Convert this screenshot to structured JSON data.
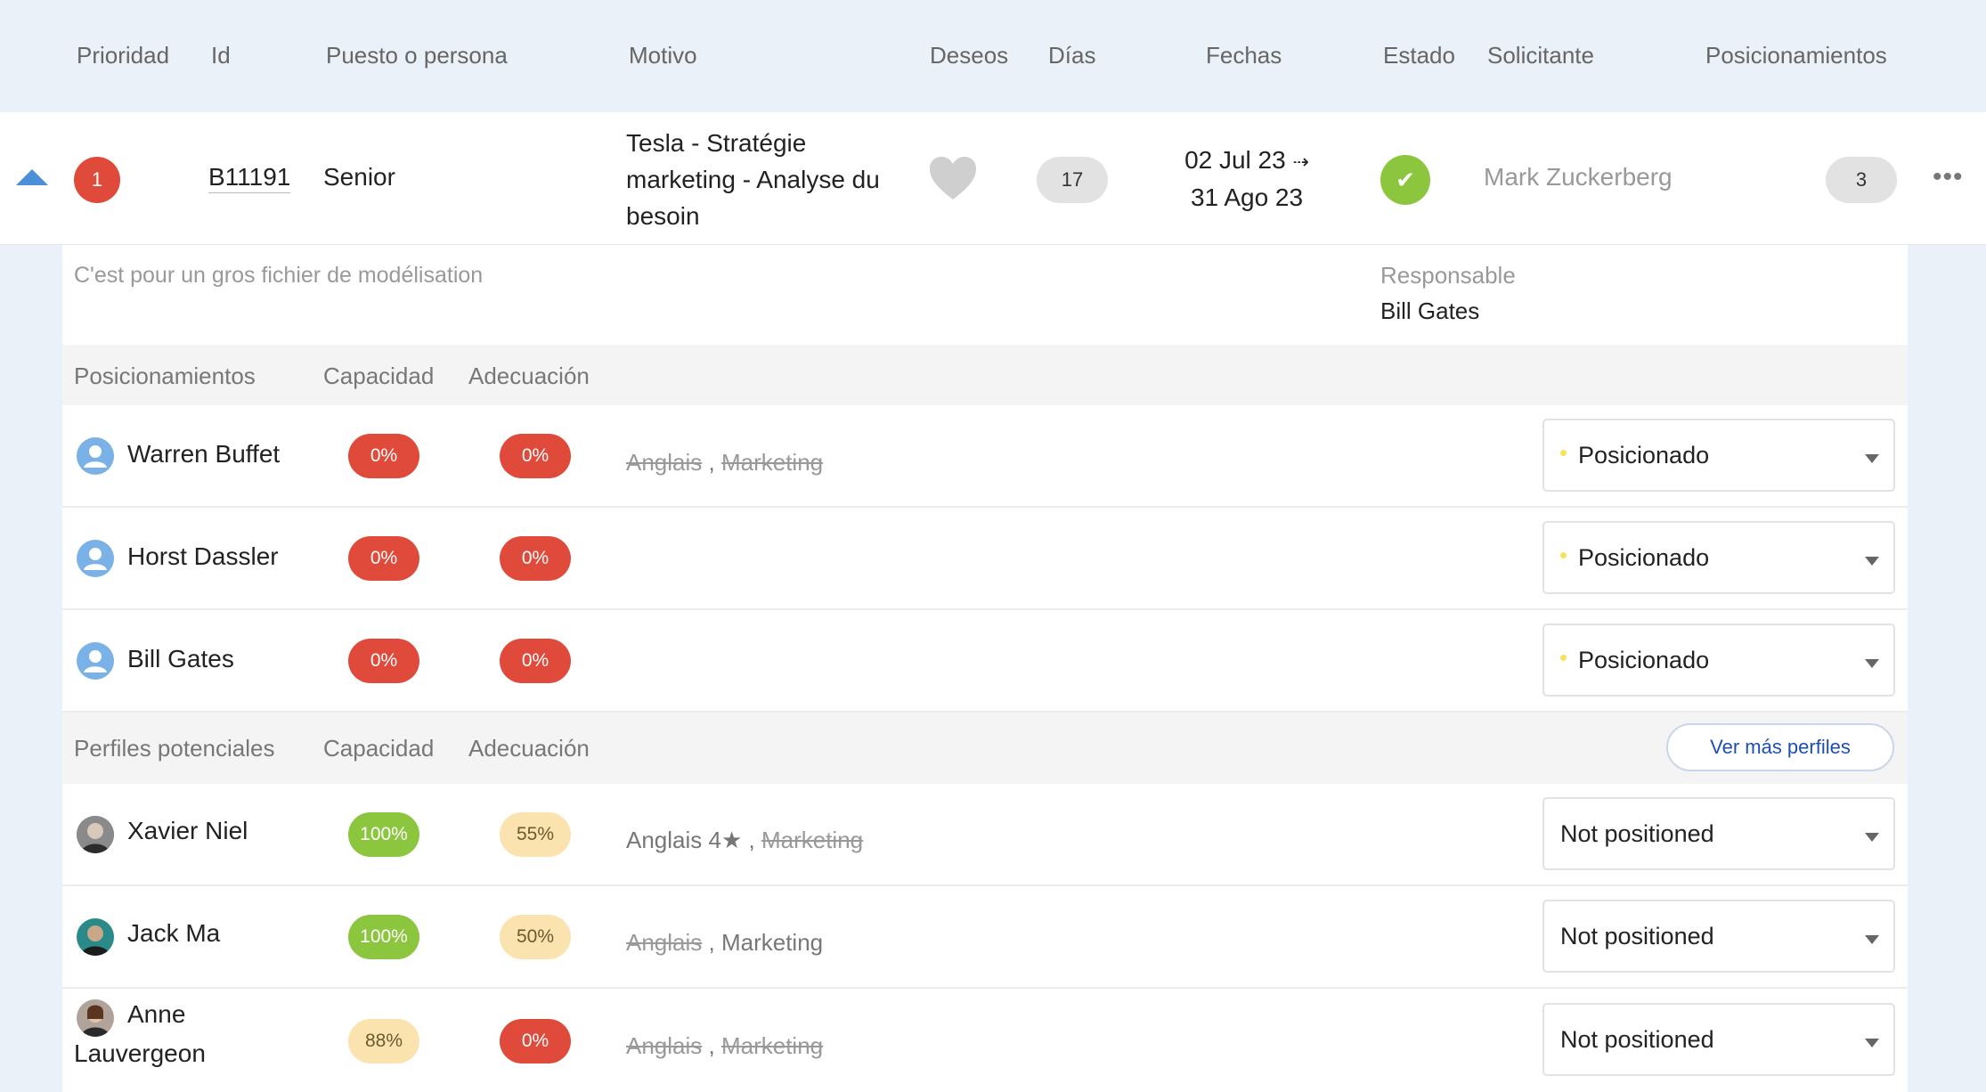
{
  "columns": {
    "prioridad": "Prioridad",
    "id": "Id",
    "puesto": "Puesto o persona",
    "motivo": "Motivo",
    "deseos": "Deseos",
    "dias": "Días",
    "fechas": "Fechas",
    "estado": "Estado",
    "solicitante": "Solicitante",
    "posicionamientos": "Posicionamientos"
  },
  "request": {
    "priority": "1",
    "id": "B11191",
    "puesto": "Senior",
    "motivo": "Tesla - Stratégie marketing - Analyse du besoin",
    "dias": "17",
    "fecha_inicio": "02 Jul 23",
    "arrow": "⇢",
    "fecha_fin": "31 Ago 23",
    "estado_icon": "✔",
    "solicitante": "Mark Zuckerberg",
    "posicionamientos_count": "3",
    "more": "•••"
  },
  "detail": {
    "description": "C'est pour un gros fichier de modélisation",
    "responsable_label": "Responsable",
    "responsable_name": "Bill Gates"
  },
  "positioned_section": {
    "title": "Posicionamientos",
    "capacidad": "Capacidad",
    "adecuacion": "Adecuación",
    "rows": [
      {
        "name": "Warren Buffet",
        "capacidad": "0%",
        "adecuacion": "0%",
        "skills": [
          {
            "text": "Anglais",
            "struck": true
          },
          {
            "text": "Marketing",
            "struck": true
          }
        ],
        "status": "Posicionado"
      },
      {
        "name": "Horst Dassler",
        "capacidad": "0%",
        "adecuacion": "0%",
        "skills": [],
        "status": "Posicionado"
      },
      {
        "name": "Bill Gates",
        "capacidad": "0%",
        "adecuacion": "0%",
        "skills": [],
        "status": "Posicionado"
      }
    ]
  },
  "potential_section": {
    "title": "Perfiles potenciales",
    "capacidad": "Capacidad",
    "adecuacion": "Adecuación",
    "more_button": "Ver más perfiles",
    "rows": [
      {
        "name": "Xavier Niel",
        "capacidad": "100%",
        "adecuacion": "55%",
        "skills": [
          {
            "text": "Anglais 4",
            "struck": false,
            "star": true
          },
          {
            "text": "Marketing",
            "struck": true
          }
        ],
        "status": "Not positioned"
      },
      {
        "name": "Jack Ma",
        "capacidad": "100%",
        "adecuacion": "50%",
        "skills": [
          {
            "text": "Anglais",
            "struck": true
          },
          {
            "text": "Marketing",
            "struck": false
          }
        ],
        "status": "Not positioned"
      },
      {
        "name": "Anne",
        "name2": "Lauvergeon",
        "capacidad": "88%",
        "adecuacion": "0%",
        "skills": [
          {
            "text": "Anglais",
            "struck": true
          },
          {
            "text": "Marketing",
            "struck": true
          }
        ],
        "status": "Not positioned"
      }
    ]
  },
  "skill_separator": " , ",
  "star_glyph": "★",
  "colors": {
    "red": "#e04a3a",
    "green": "#8cc63f",
    "yellow": "#fbe3b0",
    "blue": "#4a8fd8"
  }
}
